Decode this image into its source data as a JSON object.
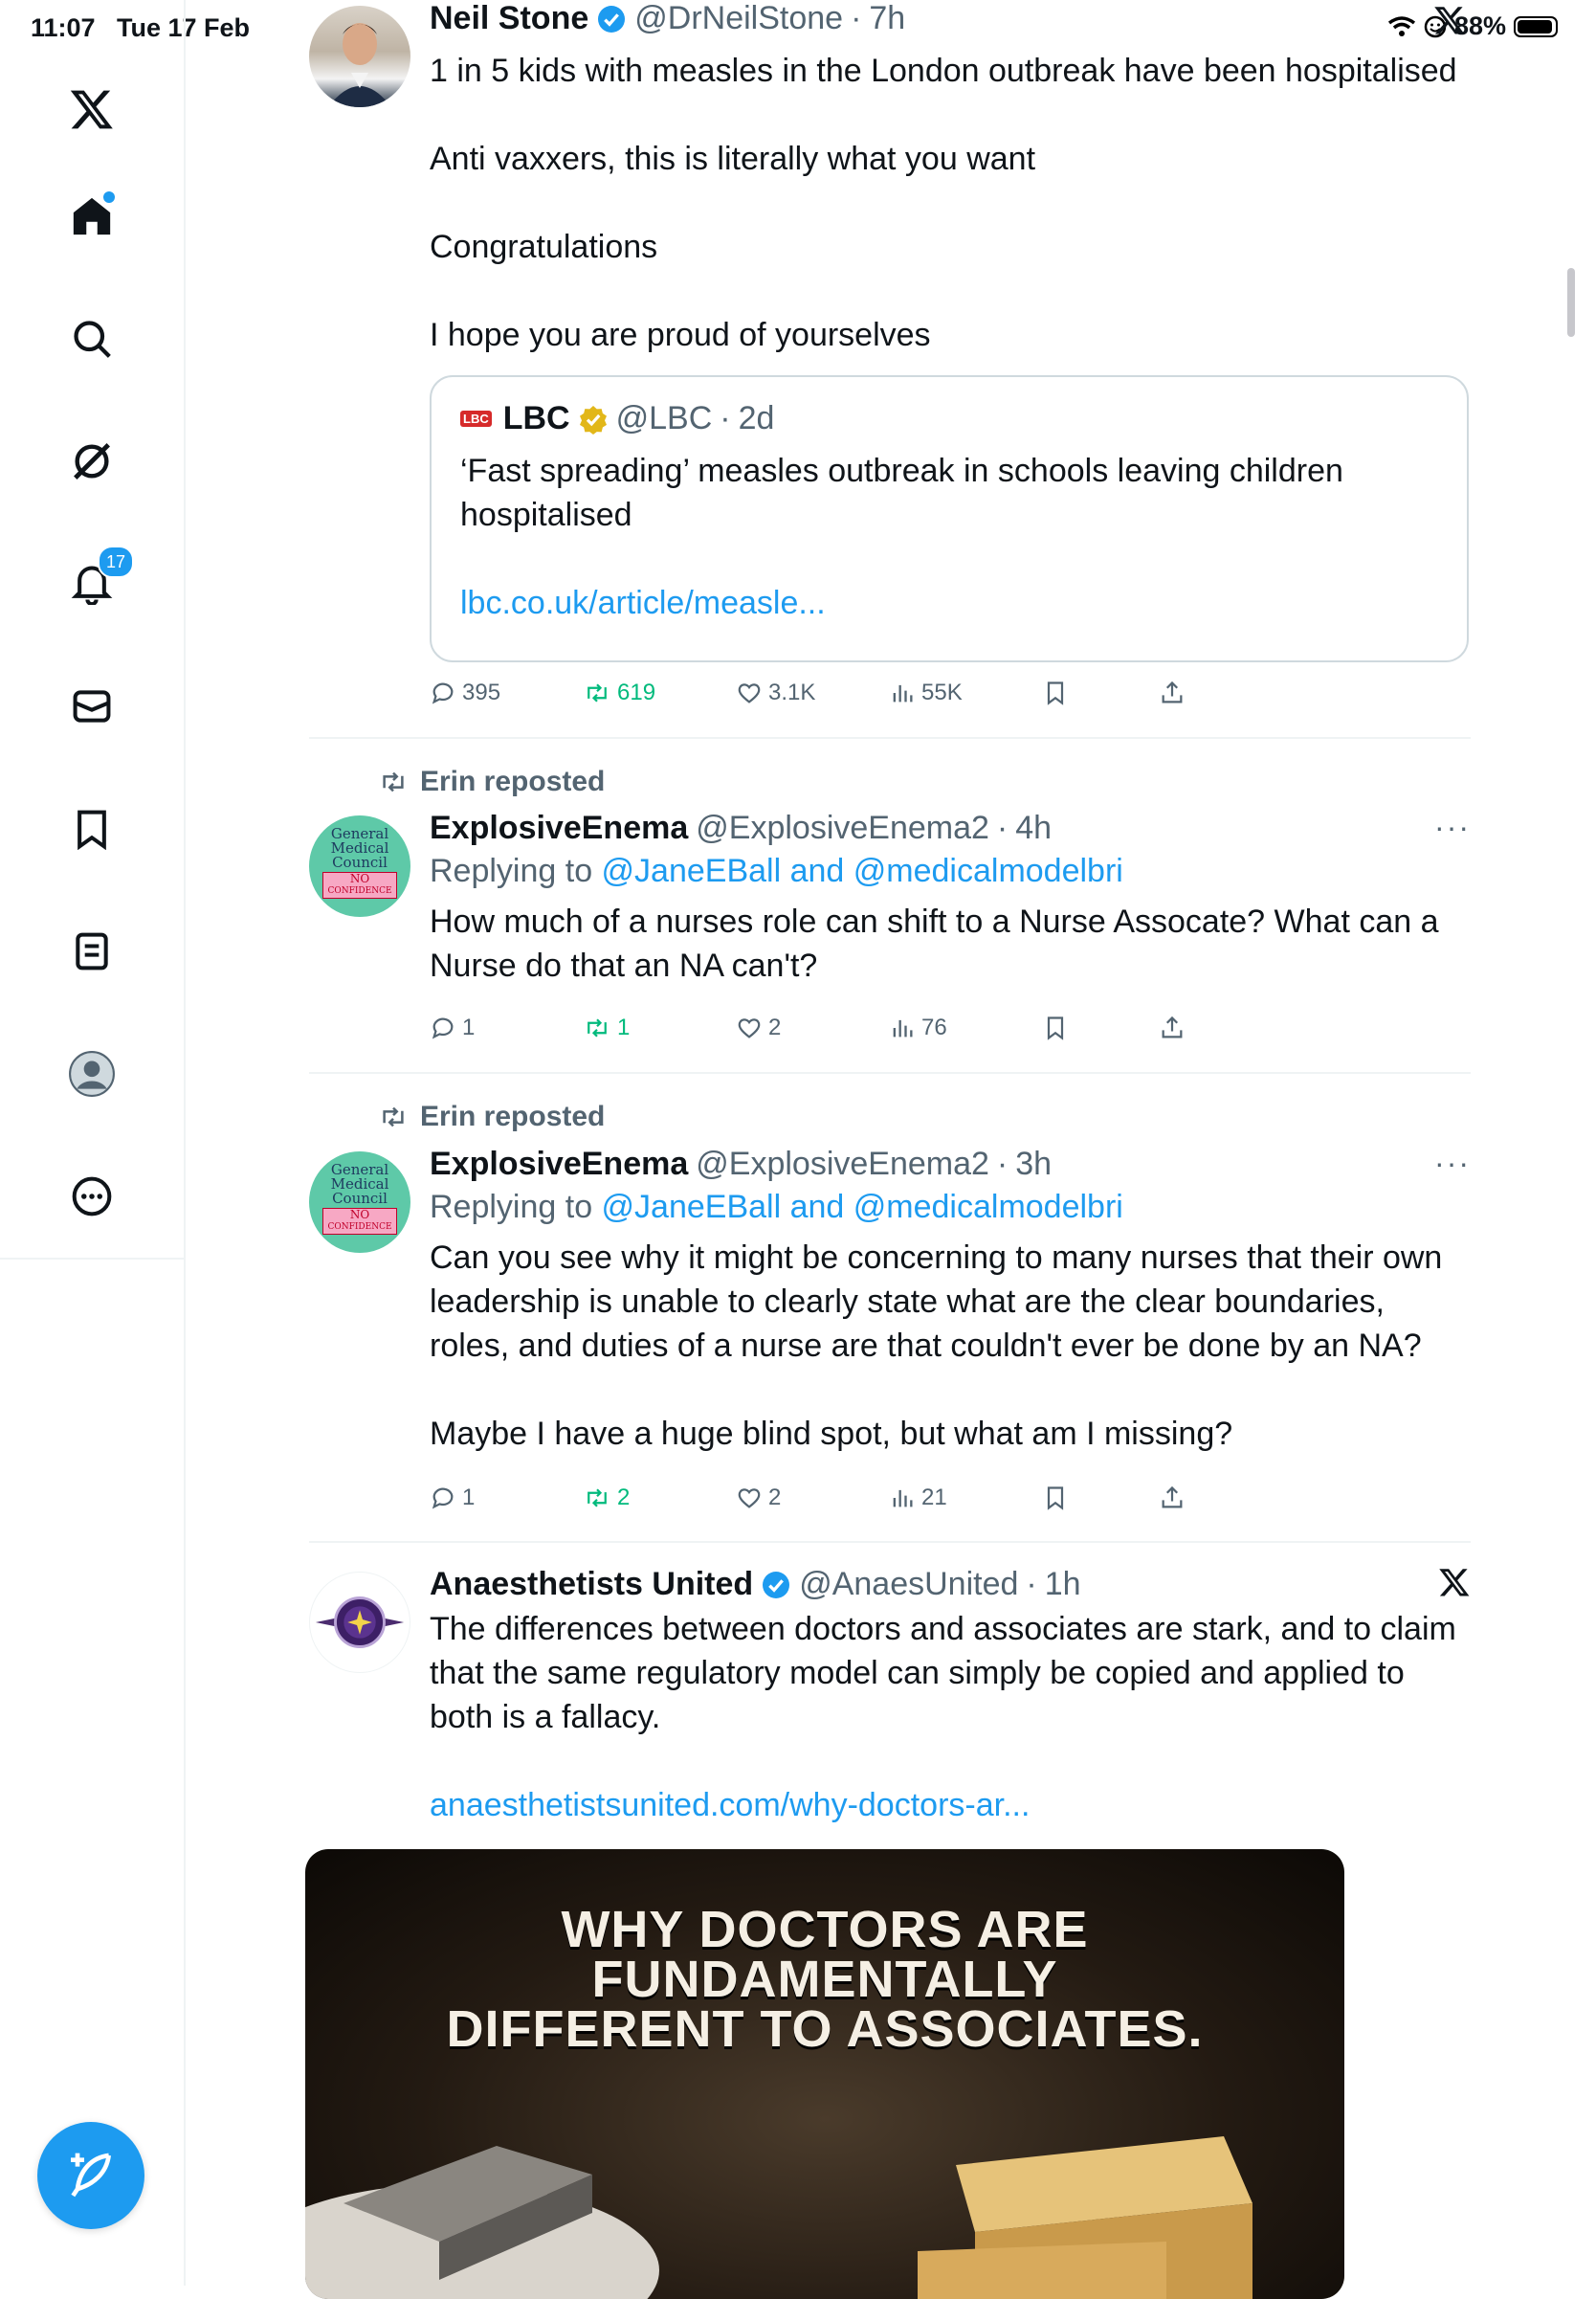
{
  "status_bar": {
    "time": "11:07",
    "date": "Tue 17 Feb",
    "battery": "88%"
  },
  "sidebar": {
    "notifications_count": "17"
  },
  "colors": {
    "accent": "#1d9bf0",
    "retweet_green": "#00ba7c",
    "secondary_text": "#536471"
  },
  "tweets": [
    {
      "name": "Neil Stone",
      "handle": "@DrNeilStone",
      "time": "7h",
      "paragraphs": [
        "1 in 5 kids with measles in the London outbreak have been hospitalised",
        "Anti vaxxers, this is literally what you want",
        "Congratulations",
        "I hope you are proud of yourselves"
      ],
      "quote": {
        "logo": "LBC",
        "name": "LBC",
        "handle": "@LBC",
        "time": "2d",
        "text": "‘Fast spreading’ measles outbreak in schools leaving children hospitalised",
        "link": "lbc.co.uk/article/measle..."
      },
      "replies": "395",
      "reposts": "619",
      "likes": "3.1K",
      "views": "55K"
    },
    {
      "reposted_by": "Erin reposted",
      "name": "ExplosiveEnema",
      "handle": "@ExplosiveEnema2",
      "time": "4h",
      "replying_prefix": "Replying to ",
      "replying_to": "@JaneEBall and @medicalmodelbri",
      "avatar_text": [
        "General",
        "Medical",
        "Council",
        "NO",
        "CONFIDENCE"
      ],
      "paragraphs": [
        "How much of a nurses role can shift to a Nurse Assocate? What can a Nurse do that an NA can't?"
      ],
      "replies": "1",
      "reposts": "1",
      "likes": "2",
      "views": "76"
    },
    {
      "reposted_by": "Erin reposted",
      "name": "ExplosiveEnema",
      "handle": "@ExplosiveEnema2",
      "time": "3h",
      "replying_prefix": "Replying to ",
      "replying_to": "@JaneEBall and @medicalmodelbri",
      "paragraphs": [
        "Can you see why it might be concerning to many nurses that their own leadership is unable to clearly state what are the clear boundaries, roles, and duties of a nurse are that couldn't ever be done by an NA?",
        "Maybe I have a huge blind spot, but what am I missing?"
      ],
      "replies": "1",
      "reposts": "2",
      "likes": "2",
      "views": "21"
    },
    {
      "name": "Anaesthetists United",
      "handle": "@AnaesUnited",
      "time": "1h",
      "paragraphs": [
        "The differences between doctors and associates are stark, and to claim that the same regulatory model can simply be copied and applied to both is a fallacy."
      ],
      "link": "anaesthetistsunited.com/why-doctors-ar...",
      "media_title": [
        "WHY DOCTORS ARE",
        "FUNDAMENTALLY",
        "DIFFERENT TO ASSOCIATES."
      ]
    }
  ]
}
